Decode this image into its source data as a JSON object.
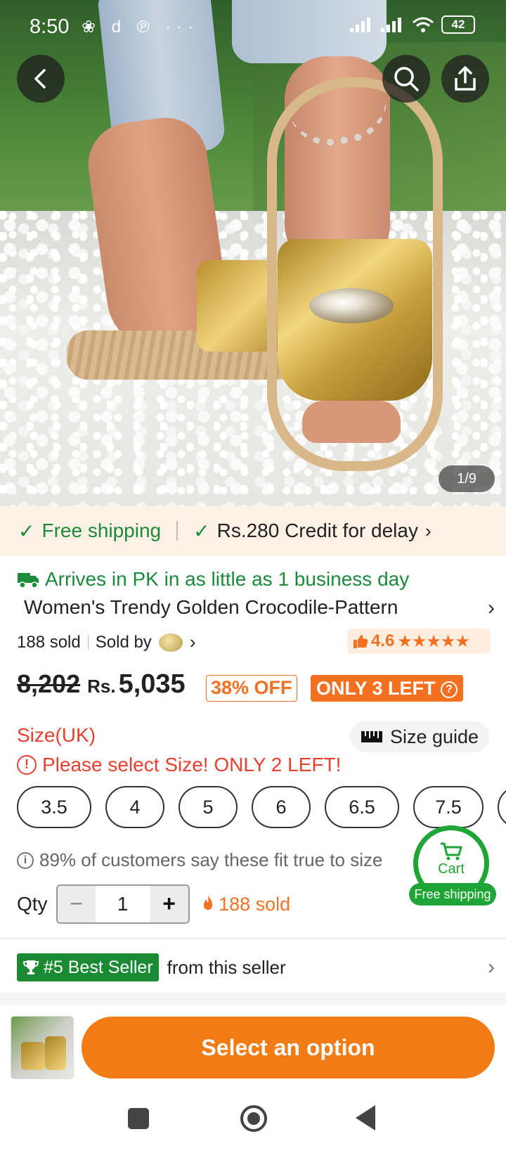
{
  "status_bar": {
    "time": "8:50",
    "notification_icons": "❀ d ℗ ···",
    "battery": "42"
  },
  "gallery": {
    "counter": "1/9"
  },
  "shipping_strip": {
    "free_shipping": "Free shipping",
    "credit": "Rs.280 Credit for delay"
  },
  "product": {
    "arrives": "Arrives in PK in as little as 1 business day",
    "title": "Women's Trendy Golden Crocodile-Pattern",
    "sold_count": "188 sold",
    "sold_by": "Sold by",
    "rating": "4.6",
    "stars": "★★★★★"
  },
  "price": {
    "old": "8,202",
    "currency": "Rs.",
    "new": "5,035",
    "discount": "38% OFF",
    "stock": "ONLY 3 LEFT"
  },
  "size": {
    "label": "Size(UK)",
    "guide": "Size guide",
    "warning": "Please select Size! ONLY 2 LEFT!",
    "options": [
      "3.5",
      "4",
      "5",
      "6",
      "6.5",
      "7.5"
    ],
    "fit_note": "89% of customers say these fit true to size"
  },
  "cart": {
    "label": "Cart",
    "free_shipping": "Free shipping"
  },
  "quantity": {
    "label": "Qty",
    "value": "1",
    "minus": "−",
    "plus": "+",
    "sold": "188 sold"
  },
  "best_seller": {
    "badge": "#5 Best Seller",
    "text": "from this seller"
  },
  "bottom": {
    "select_button": "Select an option"
  },
  "colors": {
    "accent": "#f37021",
    "green": "#1b8a3a",
    "warning": "#e8402f",
    "cart_green": "#1ea535"
  }
}
